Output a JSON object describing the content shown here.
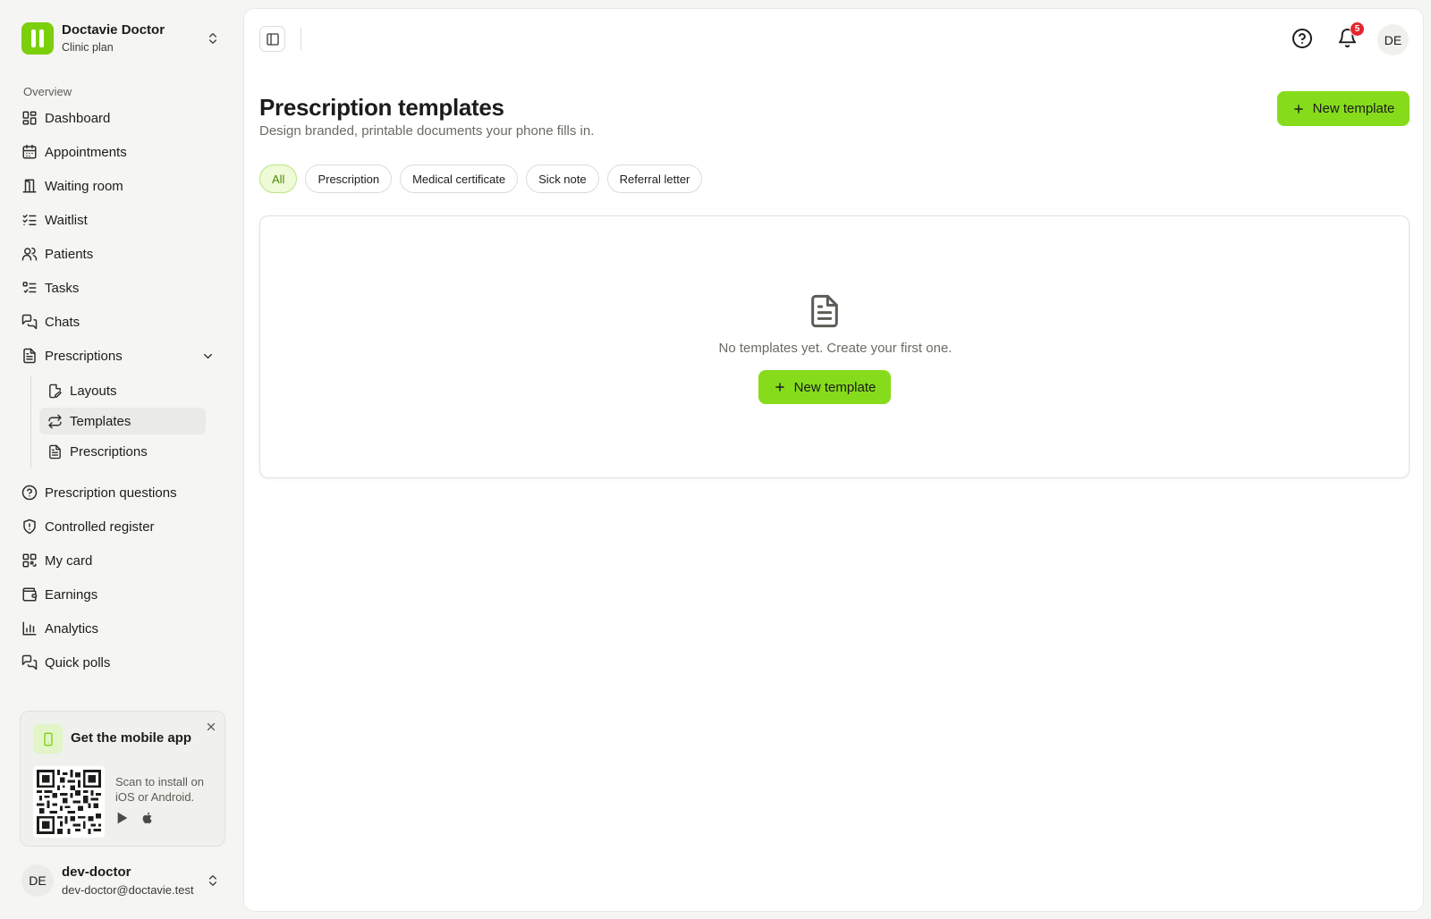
{
  "workspace": {
    "name": "Doctavie Doctor",
    "plan": "Clinic plan"
  },
  "sidebar": {
    "section_label": "Overview",
    "items": [
      {
        "label": "Dashboard",
        "icon": "dashboard-icon"
      },
      {
        "label": "Appointments",
        "icon": "calendar-icon"
      },
      {
        "label": "Waiting room",
        "icon": "door-icon"
      },
      {
        "label": "Waitlist",
        "icon": "list-checks-icon"
      },
      {
        "label": "Patients",
        "icon": "users-icon"
      },
      {
        "label": "Tasks",
        "icon": "tasks-icon"
      },
      {
        "label": "Chats",
        "icon": "chats-icon"
      },
      {
        "label": "Prescriptions",
        "icon": "file-text-icon",
        "expanded": true
      },
      {
        "label": "Prescription questions",
        "icon": "help-circle-icon"
      },
      {
        "label": "Controlled register",
        "icon": "shield-icon"
      },
      {
        "label": "My card",
        "icon": "qr-code-icon"
      },
      {
        "label": "Earnings",
        "icon": "wallet-icon"
      },
      {
        "label": "Analytics",
        "icon": "bar-chart-icon"
      },
      {
        "label": "Quick polls",
        "icon": "poll-icon"
      }
    ],
    "sub_items": [
      {
        "label": "Layouts",
        "icon": "file-edit-icon"
      },
      {
        "label": "Templates",
        "icon": "repeat-icon",
        "active": true
      },
      {
        "label": "Prescriptions",
        "icon": "file-text-icon"
      }
    ]
  },
  "promo": {
    "title": "Get the mobile app",
    "text": "Scan to install on iOS or Android.",
    "icons": [
      "phone-icon",
      "close-icon",
      "qr-code-image",
      "google-play-icon",
      "apple-icon"
    ]
  },
  "user": {
    "initials": "DE",
    "name": "dev-doctor",
    "email": "dev-doctor@doctavie.test"
  },
  "topbar": {
    "notification_count": "5",
    "avatar_initials": "DE"
  },
  "page": {
    "title": "Prescription templates",
    "subtitle": "Design branded, printable documents your phone fills in.",
    "new_button": "New template"
  },
  "filters": {
    "selected": "All",
    "options": [
      "All",
      "Prescription",
      "Medical certificate",
      "Sick note",
      "Referral letter"
    ]
  },
  "empty_state": {
    "text": "No templates yet. Create your first one.",
    "button": "New template"
  },
  "colors": {
    "accent": "#86dc1a",
    "logo": "#7ccf0d",
    "badge": "#e5262f"
  }
}
